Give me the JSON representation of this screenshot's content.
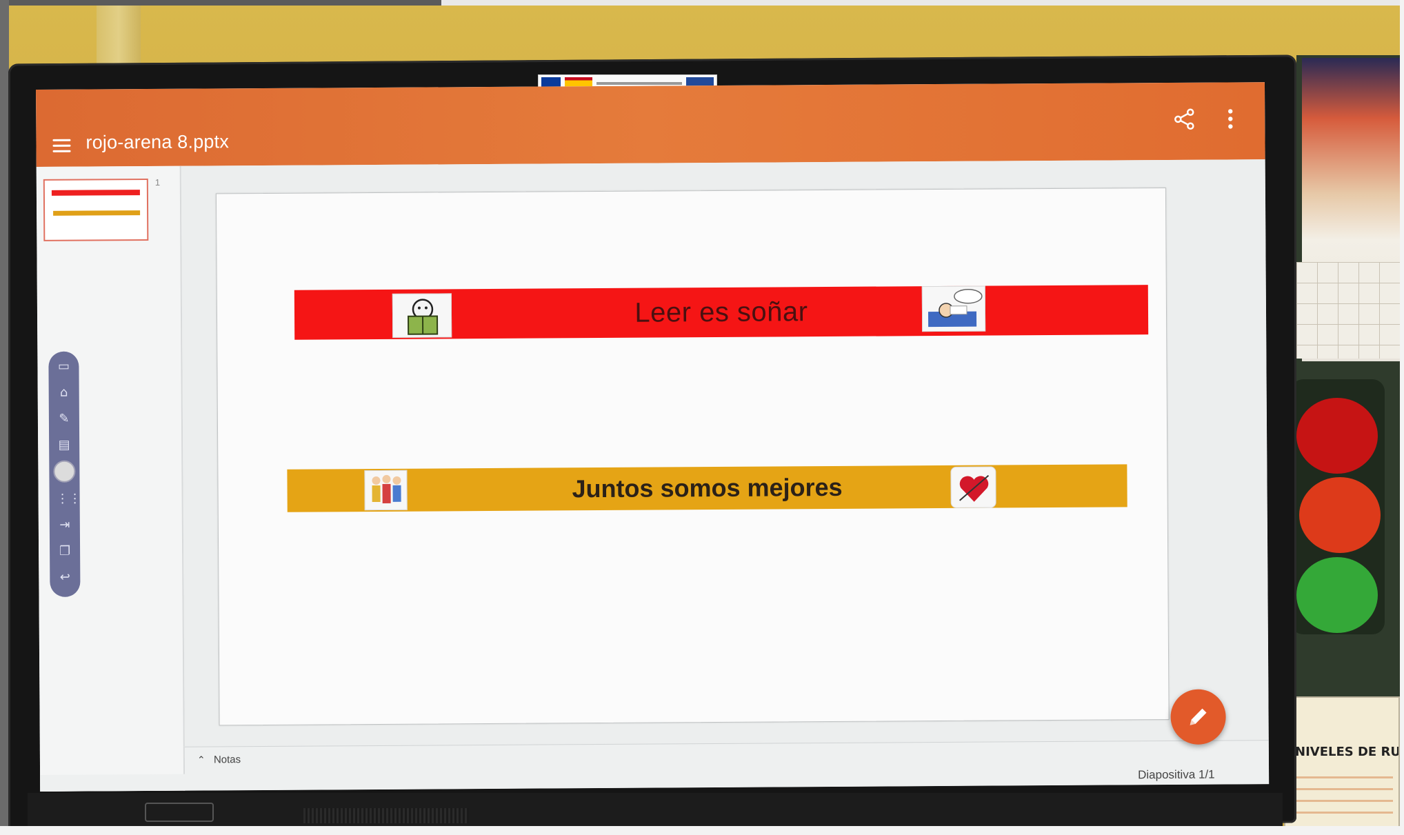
{
  "app": {
    "document_title": "rojo-arena 8.pptx",
    "accent_color": "#e57b3b"
  },
  "toolbar": {
    "menu_icon": "hamburger-menu-icon",
    "share_icon": "share-icon",
    "more_icon": "more-vertical-icon"
  },
  "thumbnails": [
    {
      "number": "1"
    }
  ],
  "floating_toolbar": {
    "icons": [
      "screen-icon",
      "home-icon",
      "edit-icon",
      "presentation-icon",
      "circle-button",
      "apps-grid-icon",
      "input-source-icon",
      "window-icon",
      "back-icon"
    ]
  },
  "slide": {
    "band1_text": "Leer es soñar",
    "band1_color": "#f51515",
    "band2_text": "Juntos somos mejores",
    "band2_color": "#e5a415",
    "pictograms": [
      "reading-pictogram",
      "sleeping-dream-pictogram",
      "group-people-pictogram",
      "heart-pictogram"
    ]
  },
  "notes": {
    "label": "Notas"
  },
  "status": {
    "slide_counter": "Diapositiva 1/1"
  },
  "fab": {
    "icon": "pencil-icon",
    "color": "#e25a2a"
  },
  "environment": {
    "noise_poster_title": "NIVELES DE RUI",
    "traffic_light_colors": [
      "#c61414",
      "#dd3a1a",
      "#34a838"
    ]
  }
}
